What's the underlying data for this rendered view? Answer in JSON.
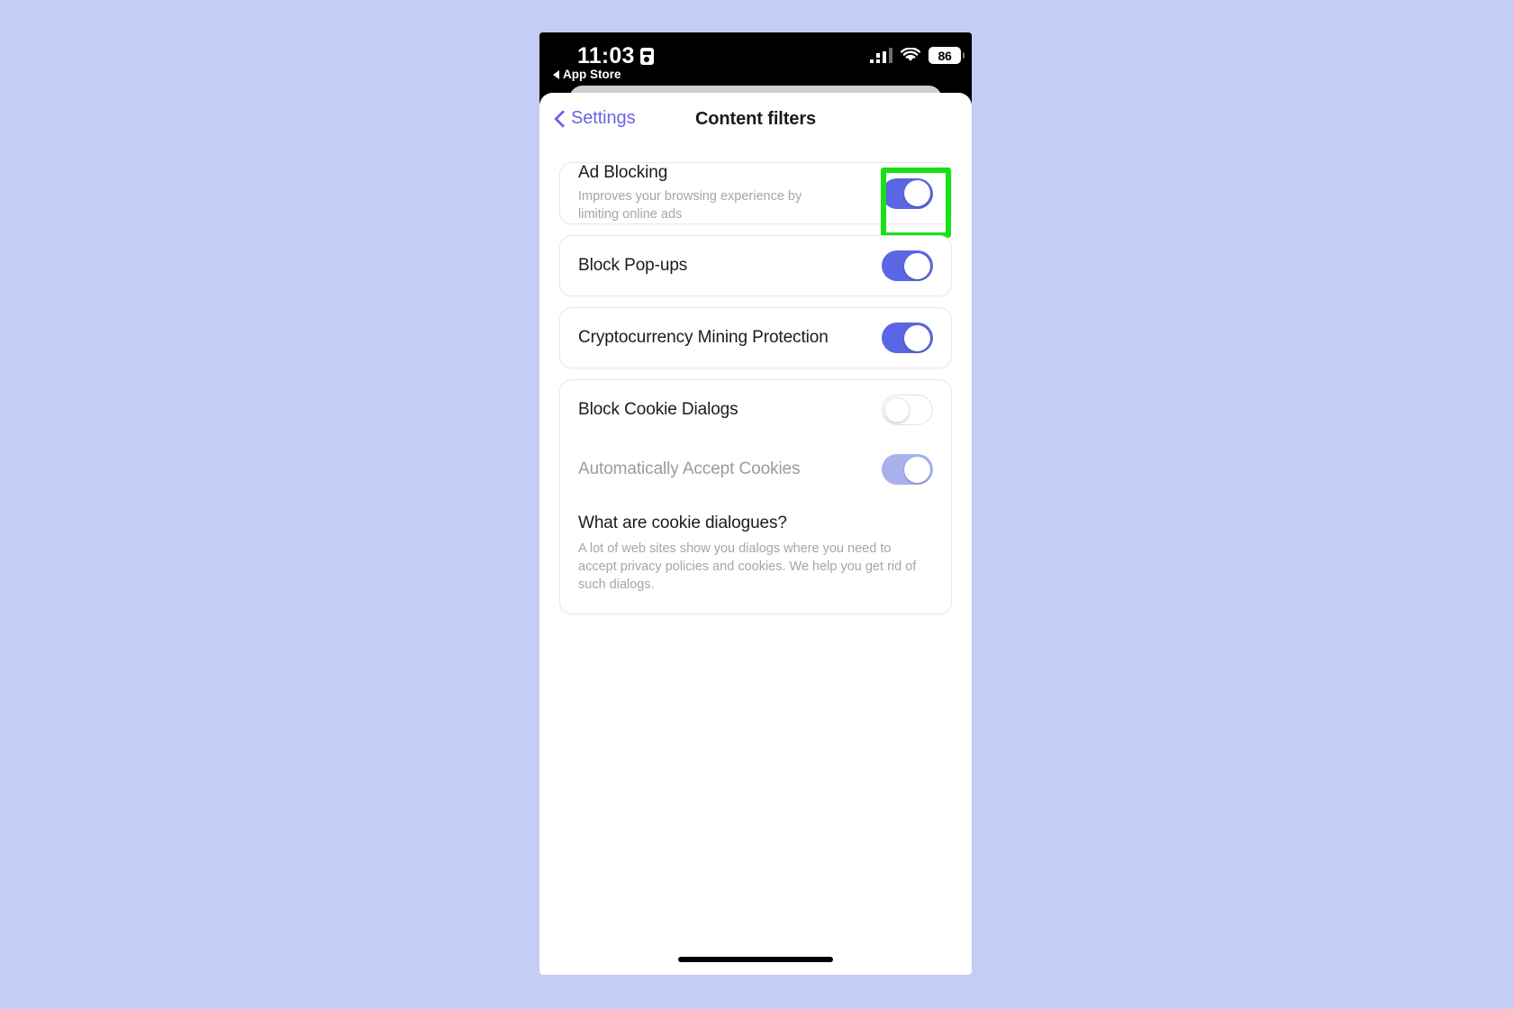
{
  "status_bar": {
    "time": "11:03",
    "recording_icon": "screen-recording-icon",
    "back_app_label": "App Store",
    "cellular_icon": "cellular-signal-icon",
    "wifi_icon": "wifi-icon",
    "battery_level": "86"
  },
  "nav": {
    "back_label": "Settings",
    "title": "Content filters"
  },
  "settings": [
    {
      "id": "ad-blocking",
      "title": "Ad Blocking",
      "subtitle": "Improves your browsing experience by limiting online ads",
      "state": "on",
      "highlighted": true
    },
    {
      "id": "block-popups",
      "title": "Block Pop-ups",
      "subtitle": "",
      "state": "on",
      "highlighted": false
    },
    {
      "id": "crypto-mining-protection",
      "title": "Cryptocurrency Mining Protection",
      "subtitle": "",
      "state": "on",
      "highlighted": false
    },
    {
      "id": "block-cookie-dialogs",
      "title": "Block Cookie Dialogs",
      "subtitle": "",
      "state": "off",
      "highlighted": false
    },
    {
      "id": "auto-accept-cookies",
      "title": "Automatically Accept Cookies",
      "subtitle": "",
      "state": "on-disabled",
      "highlighted": false
    }
  ],
  "info": {
    "title": "What are cookie dialogues?",
    "body": "A lot of web sites show you dialogs where you need to accept privacy policies and cookies. We help you get rid of such dialogs."
  },
  "colors": {
    "accent": "#5a66e4",
    "link": "#6c63e8",
    "highlight": "#19e019",
    "page_background": "#c3cdf5",
    "toggle_disabled": "#a9b0ee"
  }
}
